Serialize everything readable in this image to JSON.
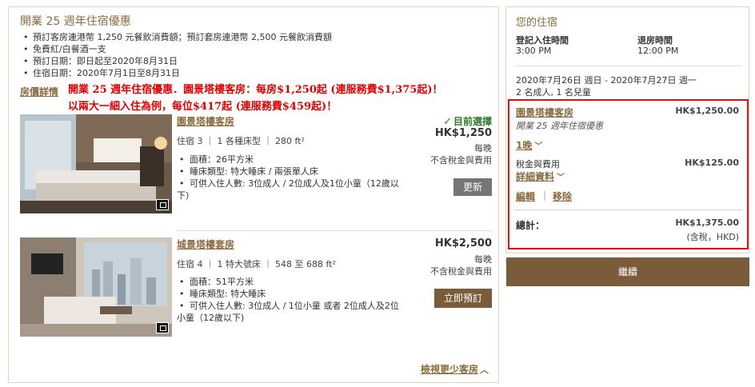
{
  "offer": {
    "title": "開業 25 週年住宿優惠",
    "items": [
      "預訂客房連港幣 1,250 元餐飲消費額；預訂套房連港幣 2,500 元餐飲消費額",
      "免費紅/白餐酒一支",
      "預訂日期：即日起至2020年8月31日",
      "住宿日期：2020年7月1日至8月31日"
    ],
    "rate_details_link": "房價詳情",
    "promo_line_1": "開業 25 週年住宿優惠．園景塔樓客房：每房$1,250起 (連服務費$1,375起)！",
    "promo_line_2": "以兩大一細入住為例，每位$417起 (連服務費$459起)！"
  },
  "rooms": [
    {
      "name": "園景塔樓客房",
      "meta": "住宿 3 ｜ 1 各種床型 ｜ 280 ft²",
      "features": [
        "面積：26平方米",
        "睡床類型: 特大睡床 / 兩張單人床"
      ],
      "feature_occupancy_a": "可供入住人數: 3位成人 / 2位成人及1位小童（12歲以",
      "feature_occupancy_b": "下)",
      "status": "目前選擇",
      "price": "HK$1,250",
      "per_night": "每晚",
      "tax_note": "不含稅金與費用",
      "button": "更新"
    },
    {
      "name": "城景塔樓套房",
      "meta": "住宿 4 ｜ 1 特大號床 ｜ 548 至 688 ft²",
      "features": [
        "面積：51平方米",
        "睡床類型: 特大睡床"
      ],
      "feature_occupancy_a": "可供入住人數: 3位成人 / 1位小童 或者 2位成人及2位",
      "feature_occupancy_b": "小童（12歲以下)",
      "price": "HK$2,500",
      "per_night": "每晚",
      "tax_note": "不含稅金與費用",
      "button": "立即預訂"
    }
  ],
  "view_less": "檢視更少客房",
  "stay": {
    "title": "您的住宿",
    "checkin_label": "登記入住時間",
    "checkin_time": "3:00 PM",
    "checkout_label": "退房時間",
    "checkout_time": "12:00 PM",
    "dates": "2020年7月26日 週日 - 2020年7月27日 週一",
    "guests": "2 名成人, 1 名兒童"
  },
  "summary": {
    "room_name": "園景塔樓客房",
    "room_price": "HK$1,250.00",
    "offer_name": "開業 25 週年住宿優惠",
    "nights": "1晚",
    "tax_label": "稅金與費用",
    "tax_price": "HK$125.00",
    "details_link": "詳細資料",
    "edit": "編輯",
    "separator": "|",
    "remove": "移除",
    "total_label": "總計：",
    "total_price": "HK$1,375.00",
    "total_note": "(含稅，HKD)"
  },
  "continue_button": "繼續",
  "colors": {
    "brand_gold": "#8a6b3e",
    "button_brown": "#7a5b3a",
    "highlight_red": "#e01010",
    "selected_green": "#2a7a2a"
  }
}
